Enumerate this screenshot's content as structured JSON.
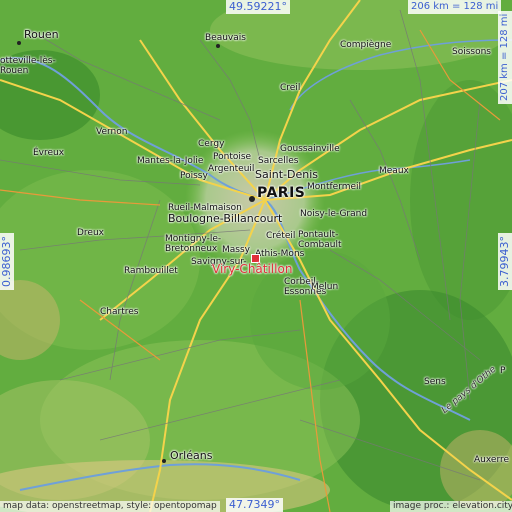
{
  "map": {
    "highlight_city": "Viry-Châtillon",
    "coords": {
      "top": "49.59221°",
      "bottom": "47.7349°",
      "left": "0.98693°",
      "right": "3.79943°"
    },
    "scale": {
      "horizontal": "206 km = 128 mi",
      "vertical": "207 km = 128 mi"
    },
    "attribution_left": "map data: openstreetmap, style: opentopomap",
    "attribution_right": "image proc.: elevation.city",
    "places": [
      {
        "id": "rouen",
        "name": "Rouen"
      },
      {
        "id": "sotteville",
        "name": "otteville-lès-\nRouen"
      },
      {
        "id": "beauvais",
        "name": "Beauvais"
      },
      {
        "id": "compiegne",
        "name": "Compiègne"
      },
      {
        "id": "soissons",
        "name": "Soissons"
      },
      {
        "id": "creil",
        "name": "Creil"
      },
      {
        "id": "vernon",
        "name": "Vernon"
      },
      {
        "id": "evreux",
        "name": "Évreux"
      },
      {
        "id": "cergy",
        "name": "Cergy"
      },
      {
        "id": "pontoise",
        "name": "Pontoise"
      },
      {
        "id": "goussainville",
        "name": "Goussainville"
      },
      {
        "id": "mantes",
        "name": "Mantes-la-Jolie"
      },
      {
        "id": "argenteuil",
        "name": "Argenteuil"
      },
      {
        "id": "sarcelles",
        "name": "Sarcelles"
      },
      {
        "id": "saintdenis",
        "name": "Saint-Denis"
      },
      {
        "id": "poissy",
        "name": "Poissy"
      },
      {
        "id": "montfermeil",
        "name": "Montfermeil"
      },
      {
        "id": "meaux",
        "name": "Meaux"
      },
      {
        "id": "paris",
        "name": "PARIS"
      },
      {
        "id": "rueil",
        "name": "Rueil-Malmaison"
      },
      {
        "id": "boulogne",
        "name": "Boulogne-Billancourt"
      },
      {
        "id": "noisy",
        "name": "Noisy-le-Grand"
      },
      {
        "id": "creteil",
        "name": "Créteil"
      },
      {
        "id": "pontault",
        "name": "Pontault-\nCombault"
      },
      {
        "id": "dreux",
        "name": "Dreux"
      },
      {
        "id": "montigny",
        "name": "Montigny-le-\nBretonneux"
      },
      {
        "id": "massy",
        "name": "Massy"
      },
      {
        "id": "athis",
        "name": "Athis-Mons"
      },
      {
        "id": "savigny",
        "name": "Savigny-sur-"
      },
      {
        "id": "rambouillet",
        "name": "Rambouillet"
      },
      {
        "id": "corbeil",
        "name": "Corbeil-\nEssonnes"
      },
      {
        "id": "melun",
        "name": "Melun"
      },
      {
        "id": "chartres",
        "name": "Chartres"
      },
      {
        "id": "sens",
        "name": "Sens"
      },
      {
        "id": "paysdothe",
        "name": "Le pays d'Othe"
      },
      {
        "id": "orleans",
        "name": "Orléans"
      },
      {
        "id": "auxerre",
        "name": "Auxerre"
      },
      {
        "id": "paren",
        "name": "P"
      }
    ]
  }
}
